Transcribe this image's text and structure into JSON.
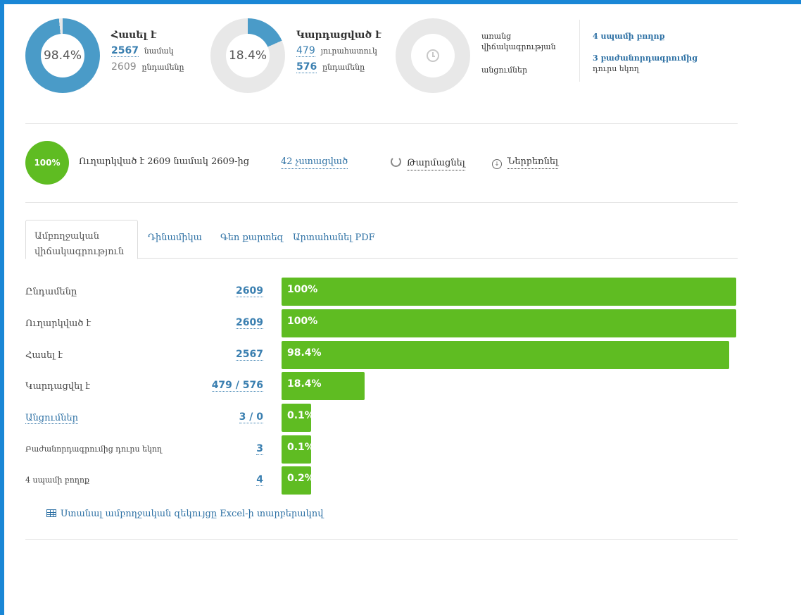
{
  "stats": {
    "opened": {
      "percent": "98.4%",
      "fraction": 0.984,
      "title": "Հասել է",
      "line1_value": "2567",
      "line1_label": "նամակ",
      "line2_value": "2609",
      "line2_label": "ընդամենը"
    },
    "read": {
      "percent": "18.4%",
      "fraction": 0.184,
      "title": "Կարդացված է",
      "line1_value": "479",
      "line1_label": "յուրահատուկ",
      "line2_value": "576",
      "line2_label": "ընդամենը"
    },
    "pending": {
      "label_line1": "առանց",
      "label_line2": "վիճակագրության",
      "label_line3": "անցումներ"
    },
    "side": {
      "link1": "4 սպամի բողոք",
      "link2": "3 բաժանորդագրումից",
      "link2_sub": "դուրս եկող"
    }
  },
  "progress": {
    "circle": "100%",
    "sent_text": "Ուղարկված է 2609 նամակ 2609-ից",
    "skipped_link": "42 չստացված",
    "refresh_label": "Թարմացնել",
    "download_label": "Ներբեռնել"
  },
  "tabs": {
    "active_line1": "Ամբողջական",
    "active_line2": "վիճակագրություն",
    "dynamics": "Դինամիկա",
    "geo": "Գեո քարտեզ",
    "pdf": "Արտահանել PDF"
  },
  "table": [
    {
      "label": "Ընդամենը",
      "value": "2609",
      "bar": "100%",
      "fraction": 1.0
    },
    {
      "label": "Ուղարկված է",
      "value": "2609",
      "bar": "100%",
      "fraction": 1.0
    },
    {
      "label": "Հասել է",
      "value": "2567",
      "bar": "98.4%",
      "fraction": 0.984
    },
    {
      "label": "Կարդացվել է",
      "value": "479 / 576",
      "bar": "18.4%",
      "fraction": 0.184
    },
    {
      "label": "Անցումներ",
      "value": "3 / 0",
      "bar": "0.1%",
      "fraction": 0.001
    },
    {
      "label": "Բաժանորդագրումից դուրս եկող",
      "value": "3",
      "bar": "0.1%",
      "fraction": 0.001
    },
    {
      "label": "4 սպամի բողոք",
      "value": "4",
      "bar": "0.2%",
      "fraction": 0.002
    }
  ],
  "excel_link": "Ստանալ ամբողջական զեկույցը Excel-ի տարբերակով",
  "colors": {
    "accent_blue": "#4a9bc8",
    "link": "#2b6fa3",
    "green": "#5fbc22",
    "frame": "#1a87d6"
  }
}
